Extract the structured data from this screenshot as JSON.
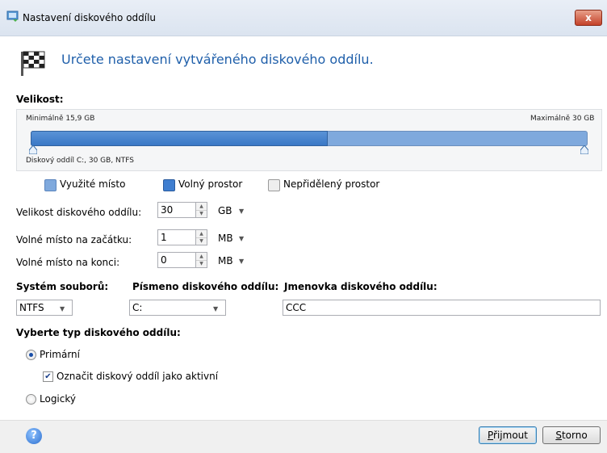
{
  "window": {
    "title": "Nastavení diskového oddílu",
    "close_label": "x"
  },
  "heading": "Určete nastavení vytvářeného diskového oddílu.",
  "size": {
    "section_label": "Velikost:",
    "min_label": "Minimálně 15,9 GB",
    "max_label": "Maximálně 30 GB",
    "partition_caption": "Diskový oddíl C:, 30 GB, NTFS",
    "used_fraction": 0.53
  },
  "legend": {
    "used": "Využité místo",
    "free": "Volný prostor",
    "unallocated": "Nepřidělený prostor",
    "colors": {
      "used": "#7fa9dd",
      "free": "#3f7ed0",
      "unallocated": "#eeeeee"
    }
  },
  "fields": {
    "size": {
      "label": "Velikost diskového oddílu:",
      "value": "30",
      "unit": "GB"
    },
    "start": {
      "label": "Volné místo na začátku:",
      "value": "1",
      "unit": "MB"
    },
    "end": {
      "label": "Volné místo na konci:",
      "value": "0",
      "unit": "MB"
    }
  },
  "filesystem": {
    "label": "Systém souborů:",
    "value": "NTFS"
  },
  "letter": {
    "label": "Písmeno diskového oddílu:",
    "value": "C:"
  },
  "volume": {
    "label": "Jmenovka diskového oddílu:",
    "value": "CCC"
  },
  "partition_type": {
    "label": "Vyberte typ diskového oddílu:",
    "primary": "Primární",
    "mark_active": "Označit diskový oddíl jako aktivní",
    "logical": "Logický",
    "selected": "primary",
    "active_checked": true
  },
  "footer": {
    "ok_first": "P",
    "ok_rest": "řijmout",
    "cancel_first": "S",
    "cancel_rest": "torno",
    "help_glyph": "?"
  },
  "icons": [
    "window-icon",
    "checkered-flag-icon",
    "help-icon",
    "close-icon"
  ]
}
